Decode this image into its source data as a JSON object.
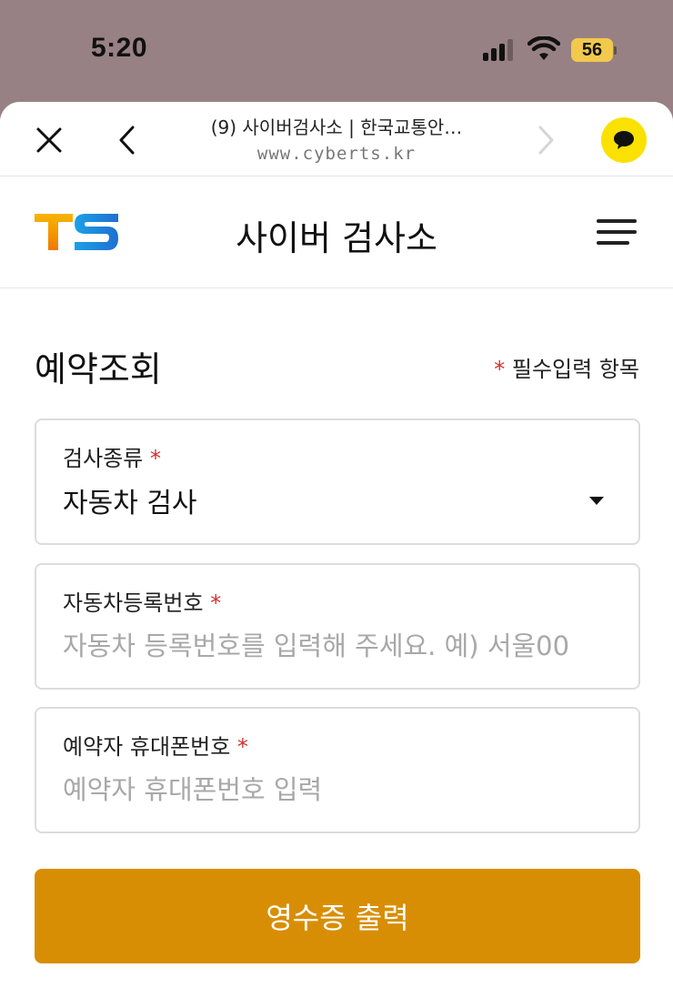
{
  "status_bar": {
    "time": "5:20",
    "battery": "56"
  },
  "browser": {
    "title": "(9) 사이버검사소 | 한국교통안…",
    "url": "www.cyberts.kr",
    "close_icon": "close-icon",
    "back_icon": "chevron-left-icon",
    "forward_icon": "chevron-right-icon",
    "kakao_icon": "chat-bubble-icon",
    "kakao_color": "#fae100"
  },
  "header": {
    "logo": "TS",
    "title": "사이버 검사소",
    "menu_icon": "hamburger-menu-icon"
  },
  "form": {
    "title": "예약조회",
    "required_star": "*",
    "required_note": "필수입력 항목",
    "fields": [
      {
        "label": "검사종류",
        "star": "*",
        "value": "자동차 검사"
      },
      {
        "label": "자동차등록번호",
        "star": "*",
        "placeholder": "자동차 등록번호를 입력해 주세요. 예) 서울00"
      },
      {
        "label": "예약자 휴대폰번호",
        "star": "*",
        "placeholder": "예약자 휴대폰번호 입력"
      }
    ],
    "submit_label": "영수증 출력"
  },
  "colors": {
    "accent": "#d88e04",
    "required": "#d0312d",
    "background_dim": "#988184"
  }
}
